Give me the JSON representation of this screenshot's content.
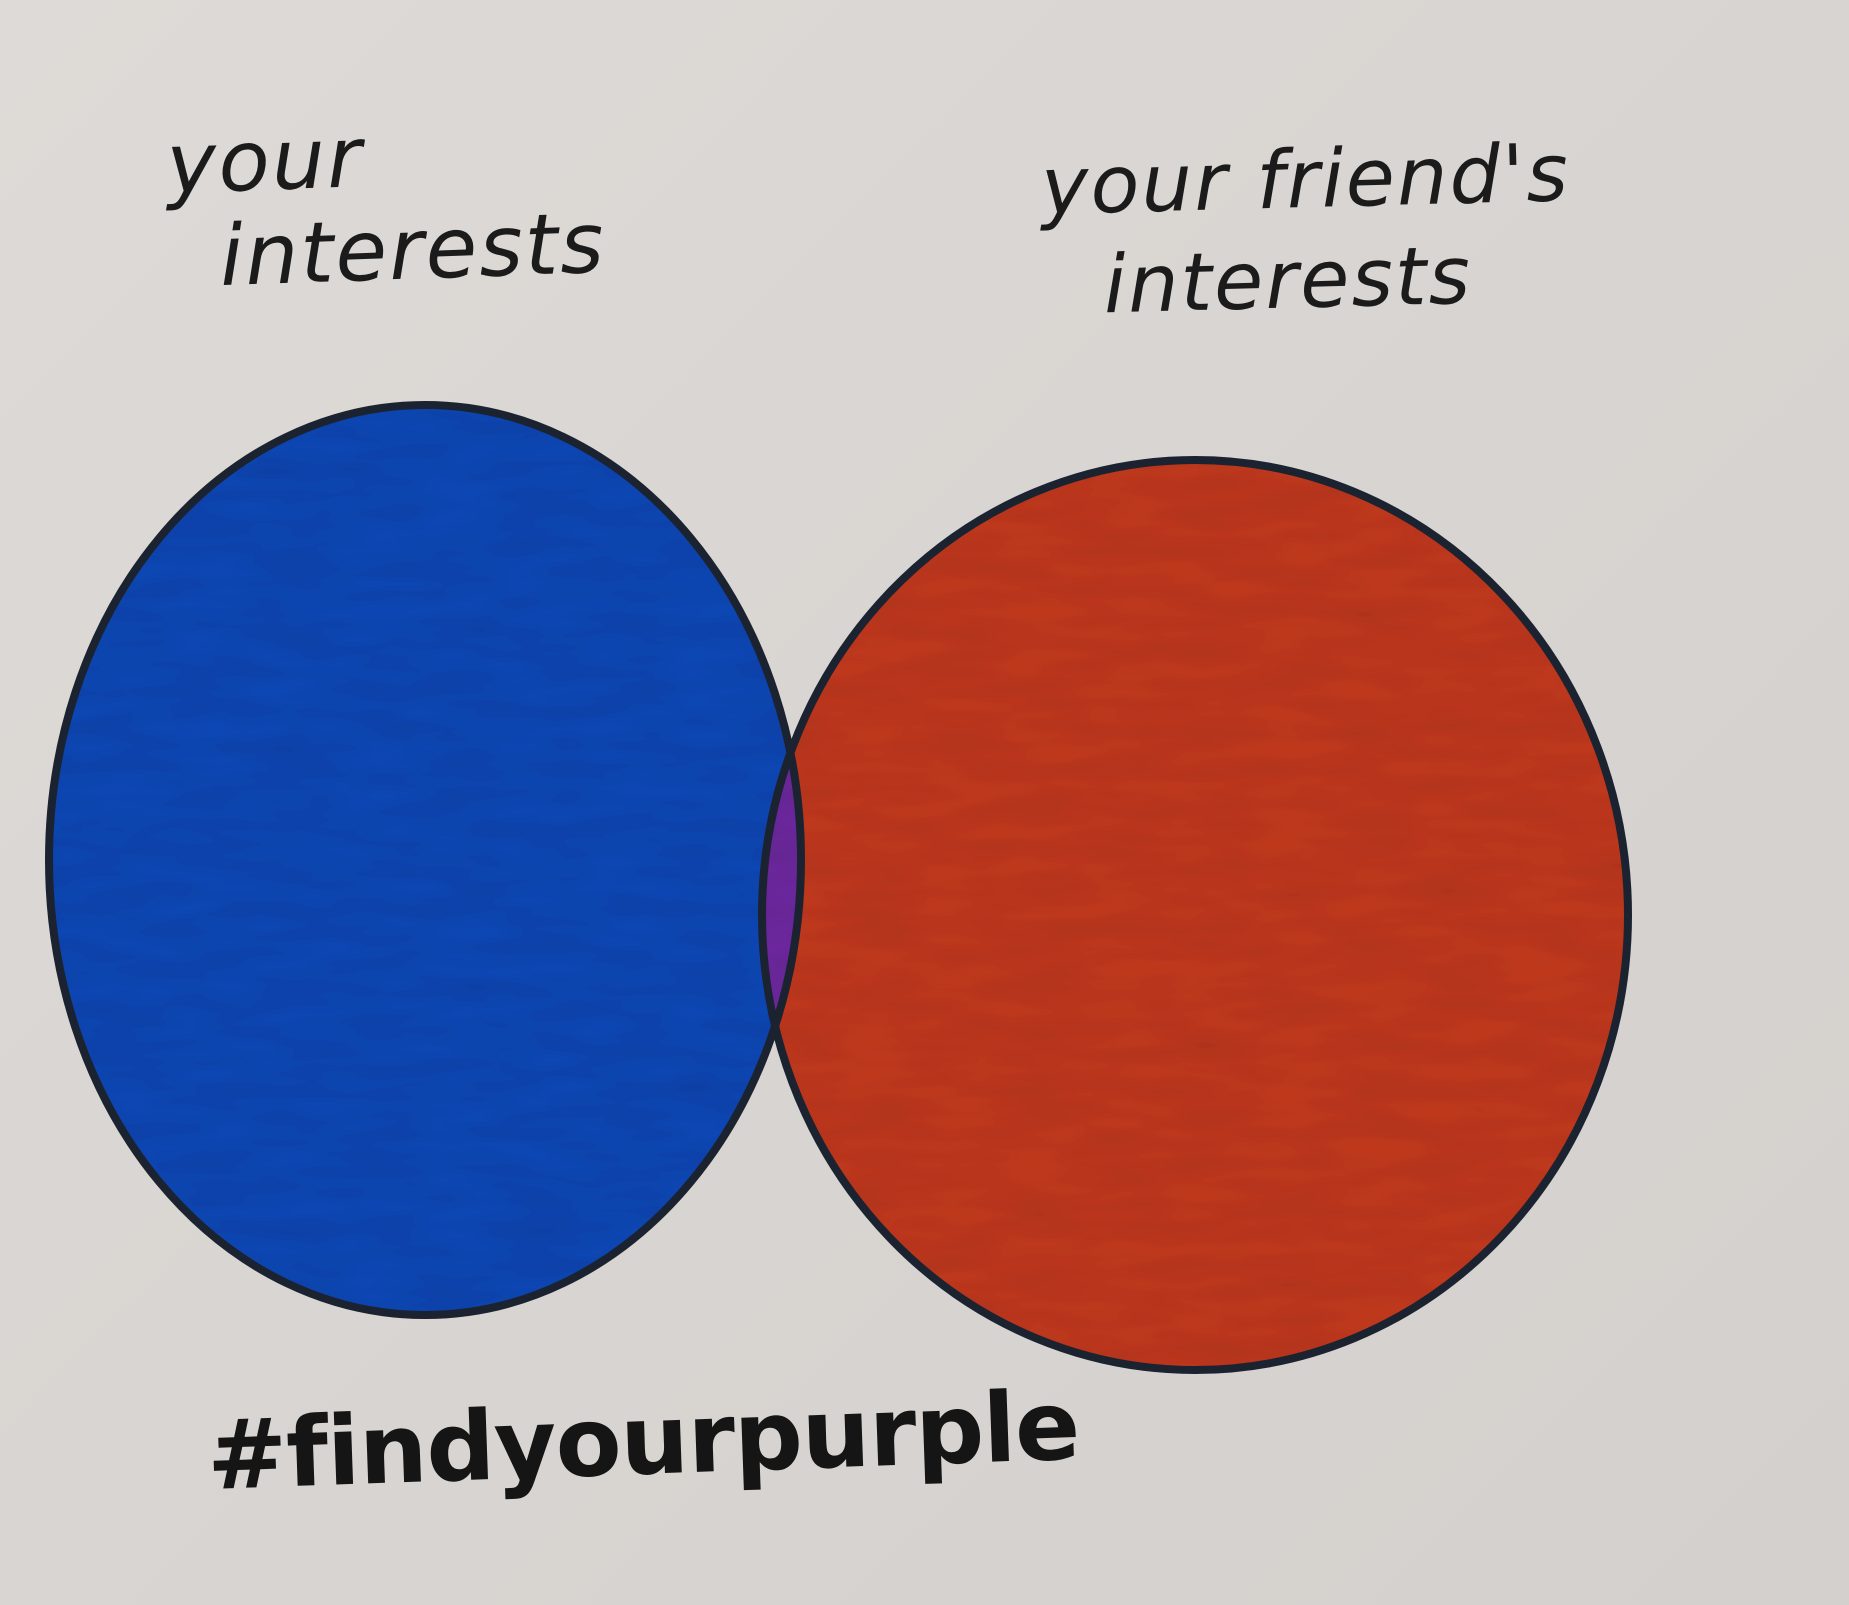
{
  "diagram": {
    "type": "venn",
    "sets": [
      {
        "line1": "your",
        "line2": "interests",
        "fill_color": "#1648b8"
      },
      {
        "line1": "your friend's",
        "line2": "interests",
        "fill_color": "#c33a24"
      }
    ],
    "overlap_color": "#6e2ca0",
    "outline_color": "#1c2330"
  },
  "caption": "#findyourpurple"
}
